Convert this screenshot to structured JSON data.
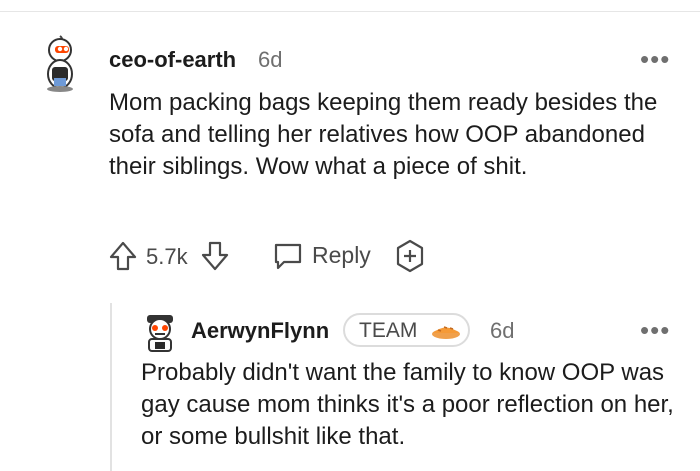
{
  "comment": {
    "username": "ceo-of-earth",
    "age": "6d",
    "body": "Mom packing bags keeping them ready besides the sofa and telling her relatives how OOP abandoned their siblings. Wow what a piece of shit.",
    "score": "5.7k",
    "reply_label": "Reply",
    "more_label": "•••"
  },
  "reply": {
    "username": "AerwynFlynn",
    "flair": "TEAM",
    "flair_icon": "pie-icon",
    "age": "6d",
    "body": "Probably didn't want the family to know OOP was gay cause mom thinks it's a poor reflection on her, or some bullshit like that.",
    "more_label": "•••"
  },
  "colors": {
    "text": "#1c1c1c",
    "muted": "#6f6f6f",
    "divider": "#e6e6e6",
    "pie": "#f59a37"
  }
}
